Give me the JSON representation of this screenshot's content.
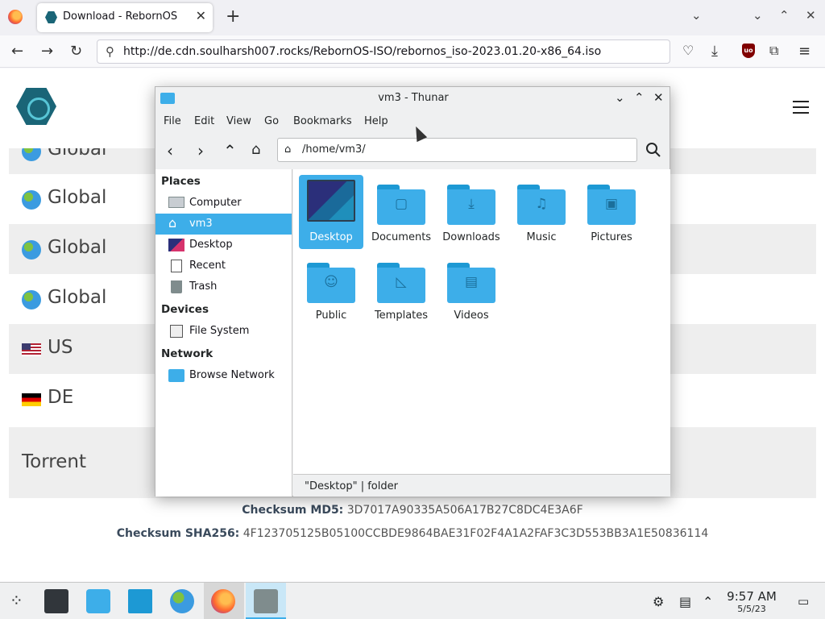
{
  "browser": {
    "tab_title": "Download - RebornOS",
    "url": "http://de.cdn.soulharsh007.rocks/RebornOS-ISO/rebornos_iso-2023.01.20-x86_64.iso"
  },
  "page": {
    "mirrors": [
      {
        "label": "Global",
        "flag": "globe-icon"
      },
      {
        "label": "Global",
        "flag": "globe-icon"
      },
      {
        "label": "Global",
        "flag": "globe-icon"
      },
      {
        "label": "Global",
        "flag": "globe-icon"
      },
      {
        "label": "US",
        "flag": "us-flag-icon"
      },
      {
        "label": "DE",
        "flag": "de-flag-icon"
      }
    ],
    "torrent_label": "Torrent",
    "md5_label": "Checksum MD5:",
    "md5_value": "3D7017A90335A506A17B27C8DC4E3A6F",
    "sha256_label": "Checksum SHA256:",
    "sha256_value": "4F123705125B05100CCBDE9864BAE31F02F4A1A2FAF3C3D553BB3A1E50836114"
  },
  "thunar": {
    "title": "vm3 - Thunar",
    "menu": [
      "File",
      "Edit",
      "View",
      "Go",
      "Bookmarks",
      "Help"
    ],
    "path": "/home/vm3/",
    "sidebar": {
      "places_heading": "Places",
      "places": [
        "Computer",
        "vm3",
        "Desktop",
        "Recent",
        "Trash"
      ],
      "devices_heading": "Devices",
      "devices": [
        "File System"
      ],
      "network_heading": "Network",
      "network": [
        "Browse Network"
      ]
    },
    "files": [
      "Desktop",
      "Documents",
      "Downloads",
      "Music",
      "Pictures",
      "Public",
      "Templates",
      "Videos"
    ],
    "status": "\"Desktop\"  |  folder"
  },
  "taskbar": {
    "time": "9:57 AM",
    "date": "5/5/23"
  },
  "colors": {
    "accent": "#3daee9",
    "brand": "#1a6577"
  }
}
